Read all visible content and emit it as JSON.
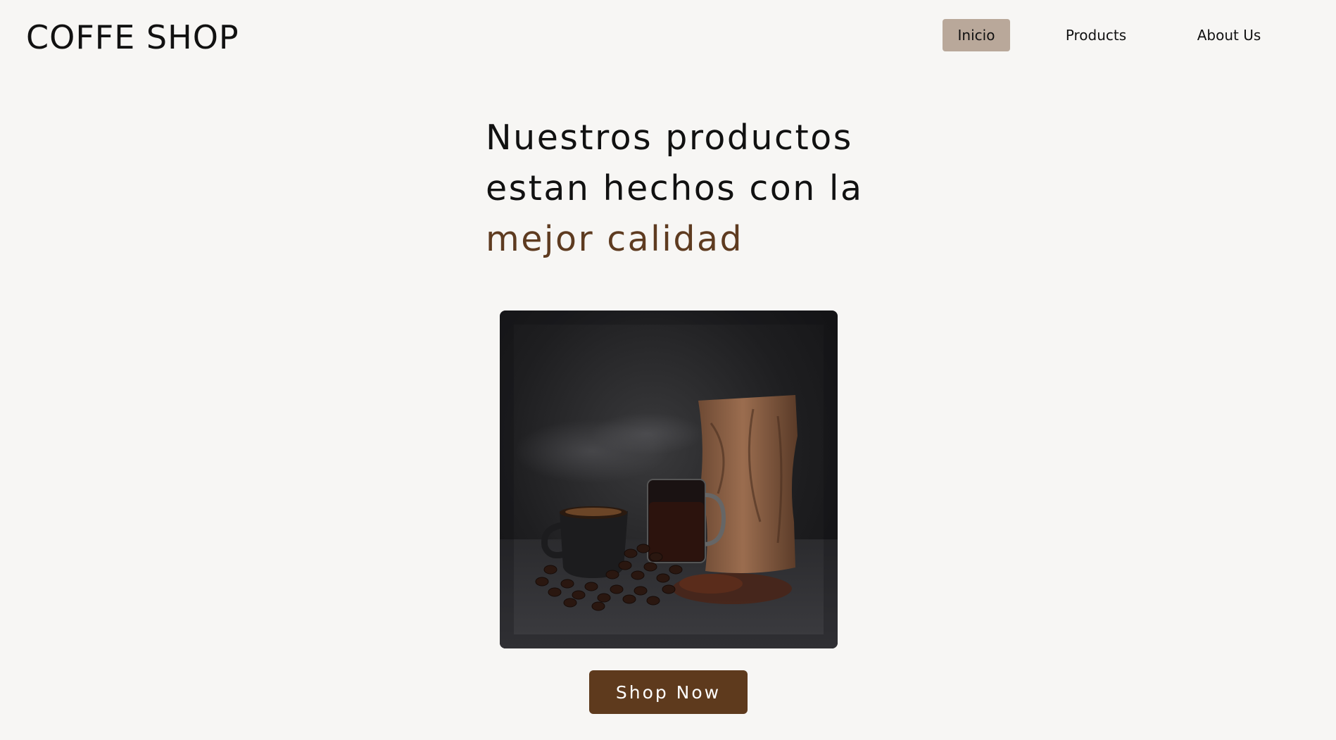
{
  "brand": {
    "title": "COFFE SHOP"
  },
  "nav": {
    "items": [
      {
        "label": "Inicio",
        "active": true
      },
      {
        "label": "Products",
        "active": false
      },
      {
        "label": "About Us",
        "active": false
      }
    ]
  },
  "hero": {
    "line1": "Nuestros productos",
    "line2": "estan hechos con la",
    "accent": "mejor calidad"
  },
  "cta": {
    "label": "Shop Now"
  },
  "colors": {
    "background": "#f7f6f4",
    "nav_active": "#b9a89a",
    "accent_text": "#5e3b20",
    "button": "#5e3a1d"
  }
}
